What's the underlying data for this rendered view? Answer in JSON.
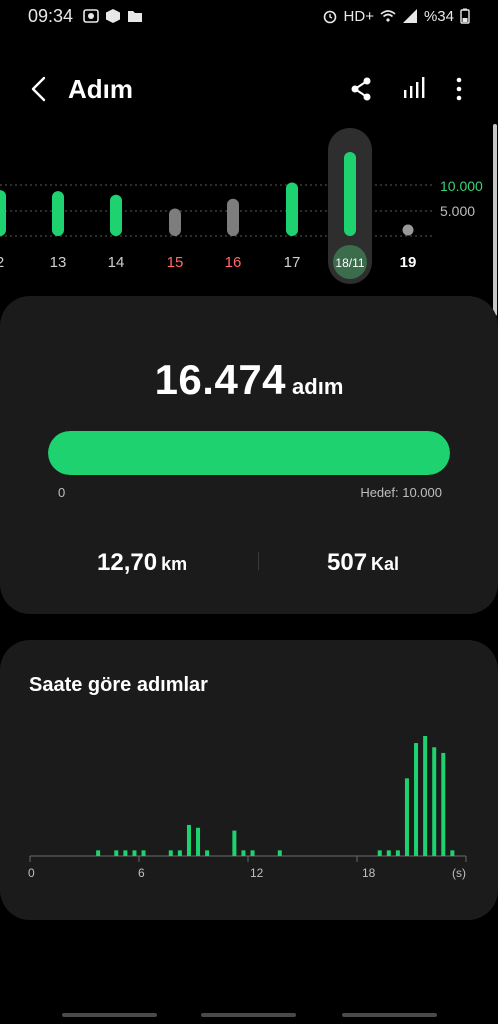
{
  "status": {
    "time": "09:34",
    "network": "HD+",
    "battery": "%34"
  },
  "appbar": {
    "title": "Adım"
  },
  "week": {
    "goal_label": "10.000",
    "half_label": "5.000",
    "days": [
      {
        "label": "2",
        "steps": 9000,
        "color": "#1ed36f",
        "style": "normal"
      },
      {
        "label": "13",
        "steps": 8800,
        "color": "#1ed36f",
        "style": "normal"
      },
      {
        "label": "14",
        "steps": 8100,
        "color": "#1ed36f",
        "style": "normal"
      },
      {
        "label": "15",
        "steps": 5400,
        "color": "#7d7d7d",
        "style": "red"
      },
      {
        "label": "16",
        "steps": 7300,
        "color": "#7d7d7d",
        "style": "red"
      },
      {
        "label": "17",
        "steps": 10500,
        "color": "#1ed36f",
        "style": "normal"
      },
      {
        "label": "18/11",
        "steps": 16474,
        "color": "#1ed36f",
        "style": "selected"
      },
      {
        "label": "19",
        "steps": 0,
        "color": "#9a9a9a",
        "style": "bold"
      }
    ]
  },
  "summary": {
    "steps": "16.474",
    "steps_unit": "adım",
    "progress": 1.0,
    "min_label": "0",
    "goal_label": "Hedef: 10.000",
    "distance": "12,70",
    "distance_unit": "km",
    "calories": "507",
    "calories_unit": "Kal"
  },
  "hourly": {
    "title": "Saate göre adımlar",
    "ticks": [
      "0",
      "6",
      "12",
      "18",
      "(s)"
    ],
    "values": [
      0,
      0,
      0,
      0,
      0,
      0,
      0,
      0.04,
      0,
      0.04,
      0.04,
      0.04,
      0.04,
      0,
      0,
      0.04,
      0.04,
      0.22,
      0.2,
      0.04,
      0,
      0,
      0.18,
      0.04,
      0.04,
      0,
      0,
      0.04,
      0,
      0,
      0,
      0,
      0,
      0,
      0,
      0,
      0,
      0,
      0.04,
      0.04,
      0.04,
      0.55,
      0.8,
      0.85,
      0.77,
      0.73,
      0.04,
      0
    ]
  }
}
